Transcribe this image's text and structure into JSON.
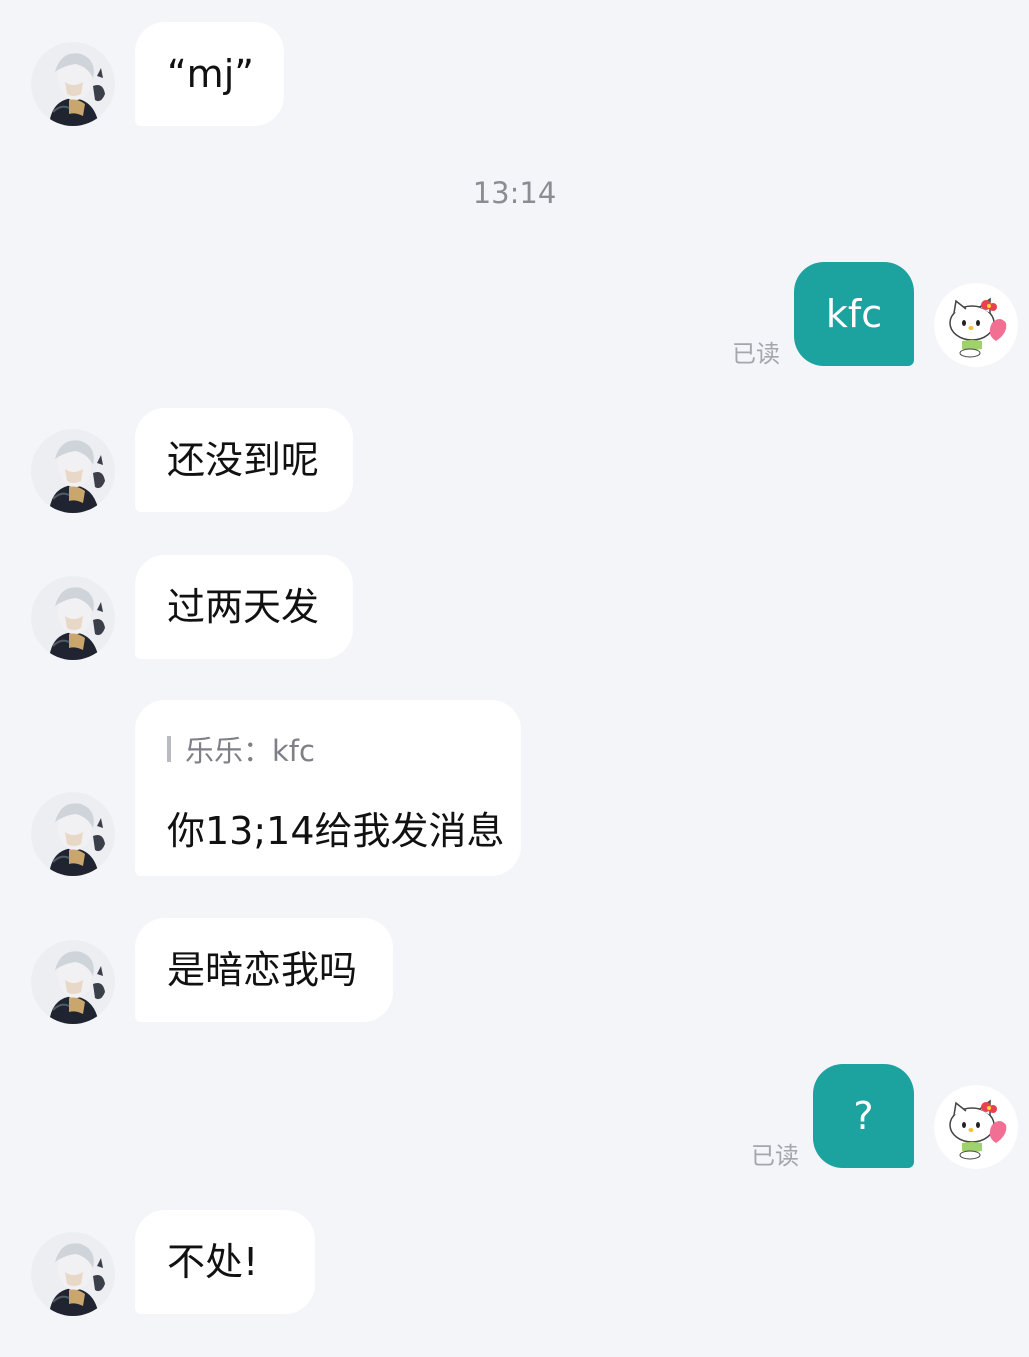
{
  "timestamp": "13:14",
  "messages": [
    {
      "side": "left",
      "text": "“mj”"
    },
    {
      "side": "right",
      "text": "kfc",
      "status": "已读"
    },
    {
      "side": "left",
      "text": "还没到呢"
    },
    {
      "side": "left",
      "text": "过两天发"
    },
    {
      "side": "left",
      "quote": "乐乐：kfc",
      "text": "你13;14给我发消息"
    },
    {
      "side": "left",
      "text": "是暗恋我吗"
    },
    {
      "side": "right",
      "text": "?",
      "status": "已读"
    },
    {
      "side": "left",
      "text": "不处!"
    }
  ],
  "colors": {
    "background": "#f3f5f8",
    "outgoing_bubble": "#1da39f",
    "incoming_bubble": "#ffffff"
  },
  "icons": {
    "contact_avatar": "anime-character-avatar",
    "my_avatar": "hello-kitty-avatar"
  }
}
